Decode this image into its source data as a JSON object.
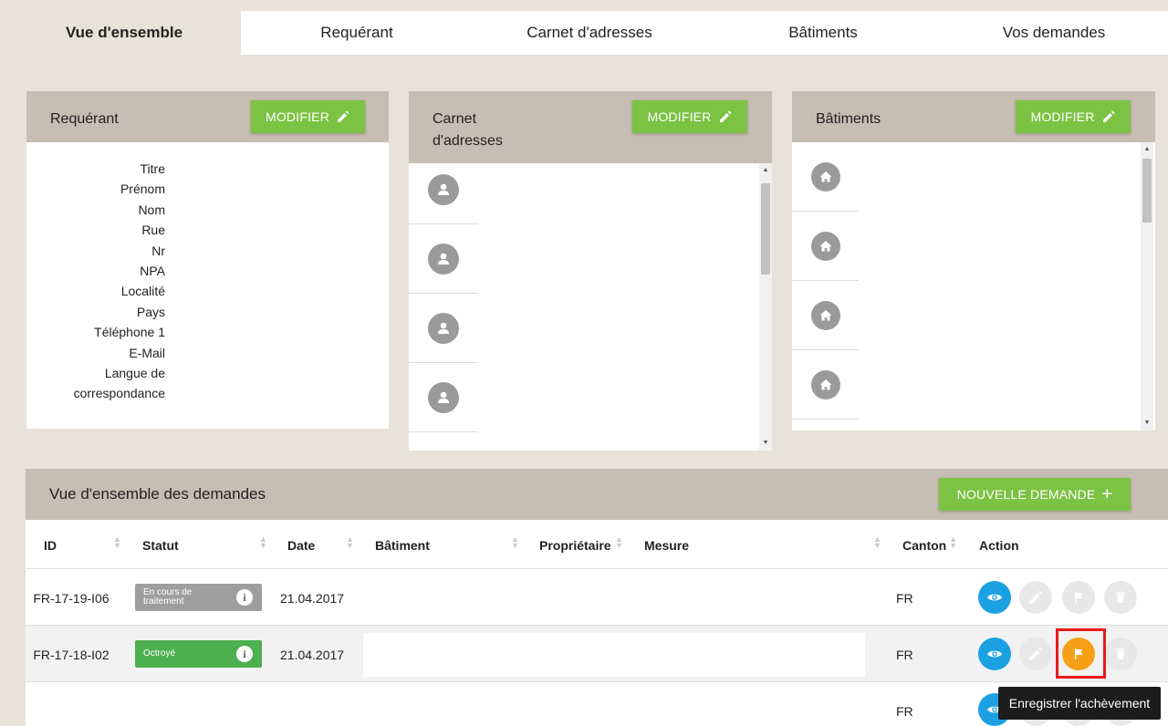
{
  "tabs": [
    {
      "label": "Vue d'ensemble"
    },
    {
      "label": "Requérant"
    },
    {
      "label": "Carnet d'adresses"
    },
    {
      "label": "Bâtiments"
    },
    {
      "label": "Vos demandes"
    }
  ],
  "requerant": {
    "title": "Requérant",
    "modify_label": "MODIFIER",
    "fields": [
      "Titre",
      "Prénom",
      "Nom",
      "Rue",
      "Nr",
      "NPA",
      "Localité",
      "Pays",
      "Téléphone 1",
      "E-Mail",
      "Langue de",
      "correspondance"
    ]
  },
  "carnet": {
    "title_line1": "Carnet",
    "title_line2": "d'adresses",
    "modify_label": "MODIFIER",
    "items": [
      "person-icon",
      "person-icon",
      "person-icon",
      "person-icon"
    ]
  },
  "batiments": {
    "title": "Bâtiments",
    "modify_label": "MODIFIER",
    "items": [
      "home-icon",
      "home-icon",
      "home-icon",
      "home-icon"
    ]
  },
  "demandes": {
    "title": "Vue d'ensemble des demandes",
    "new_label": "NOUVELLE DEMANDE",
    "columns": {
      "id": "ID",
      "statut": "Statut",
      "date": "Date",
      "batiment": "Bâtiment",
      "proprietaire": "Propriétaire",
      "mesure": "Mesure",
      "canton": "Canton",
      "action": "Action"
    },
    "rows": [
      {
        "id": "FR-17-19-I06",
        "status_line1": "En cours de",
        "status_line2": "traitement",
        "date": "21.04.2017",
        "canton": "FR"
      },
      {
        "id": "FR-17-18-I02",
        "status_line1": "Octroyé",
        "status_line2": "",
        "date": "21.04.2017",
        "canton": "FR"
      },
      {
        "id": "",
        "status_line1": "",
        "status_line2": "",
        "date": "",
        "canton": "FR"
      }
    ]
  },
  "tooltip": "Enregistrer l'achèvement",
  "colors": {
    "green": "#7cc243",
    "status_grey": "#9e9e9e",
    "status_green": "#4caf50",
    "blue": "#1ba1e2",
    "orange": "#f6a018",
    "highlight": "#e81b1b"
  }
}
